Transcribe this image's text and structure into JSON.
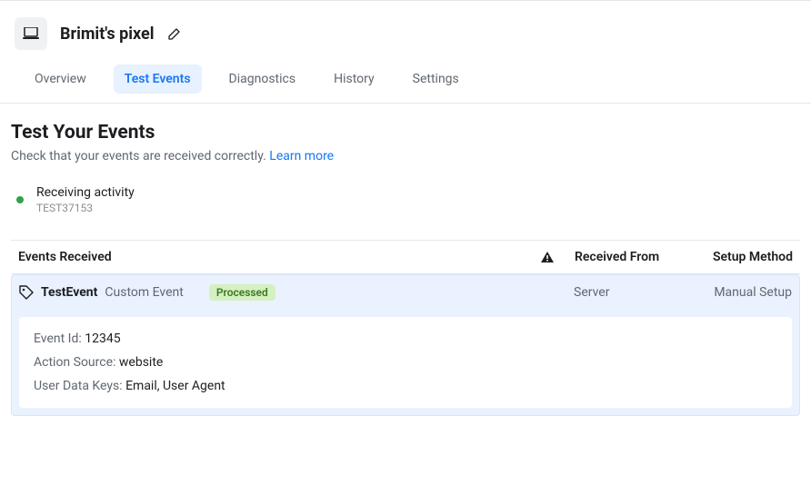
{
  "header": {
    "title": "Brimit's pixel"
  },
  "tabs": {
    "overview": "Overview",
    "test_events": "Test Events",
    "diagnostics": "Diagnostics",
    "history": "History",
    "settings": "Settings"
  },
  "section": {
    "title": "Test Your Events",
    "desc": "Check that your events are received correctly. ",
    "learn_more": "Learn more"
  },
  "status": {
    "label": "Receiving activity",
    "id": "TEST37153"
  },
  "table": {
    "events_received": "Events Received",
    "received_from": "Received From",
    "setup_method": "Setup Method"
  },
  "event": {
    "name": "TestEvent",
    "type": "Custom Event",
    "badge": "Processed",
    "received_from": "Server",
    "setup_method": "Manual Setup",
    "details": {
      "event_id_label": "Event Id: ",
      "event_id_value": "12345",
      "action_source_label": "Action Source: ",
      "action_source_value": "website",
      "user_data_keys_label": "User Data Keys: ",
      "user_data_keys_value": "Email, User Agent"
    }
  }
}
